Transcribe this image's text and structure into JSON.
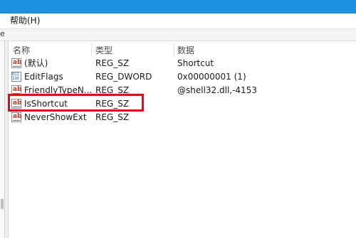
{
  "menubar": {
    "help_label": "帮助(H)"
  },
  "addressbar": {
    "visible_glyph": "e"
  },
  "list": {
    "columns": {
      "name": "名称",
      "type": "类型",
      "data": "数据"
    },
    "rows": [
      {
        "name": "(默认)",
        "type": "REG_SZ",
        "data": "Shortcut",
        "icon": "string-value-icon"
      },
      {
        "name": "EditFlags",
        "type": "REG_DWORD",
        "data": "0x00000001 (1)",
        "icon": "binary-value-icon"
      },
      {
        "name": "FriendlyTypeN...",
        "type": "REG_SZ",
        "data": "@shell32.dll,-4153",
        "icon": "string-value-icon"
      },
      {
        "name": "IsShortcut",
        "type": "REG_SZ",
        "data": "",
        "icon": "string-value-icon",
        "highlighted": true
      },
      {
        "name": "NeverShowExt",
        "type": "REG_SZ",
        "data": "",
        "icon": "string-value-icon"
      }
    ]
  },
  "colors": {
    "titlebar": "#1c8fe2",
    "highlight_outline": "#d4141a"
  }
}
